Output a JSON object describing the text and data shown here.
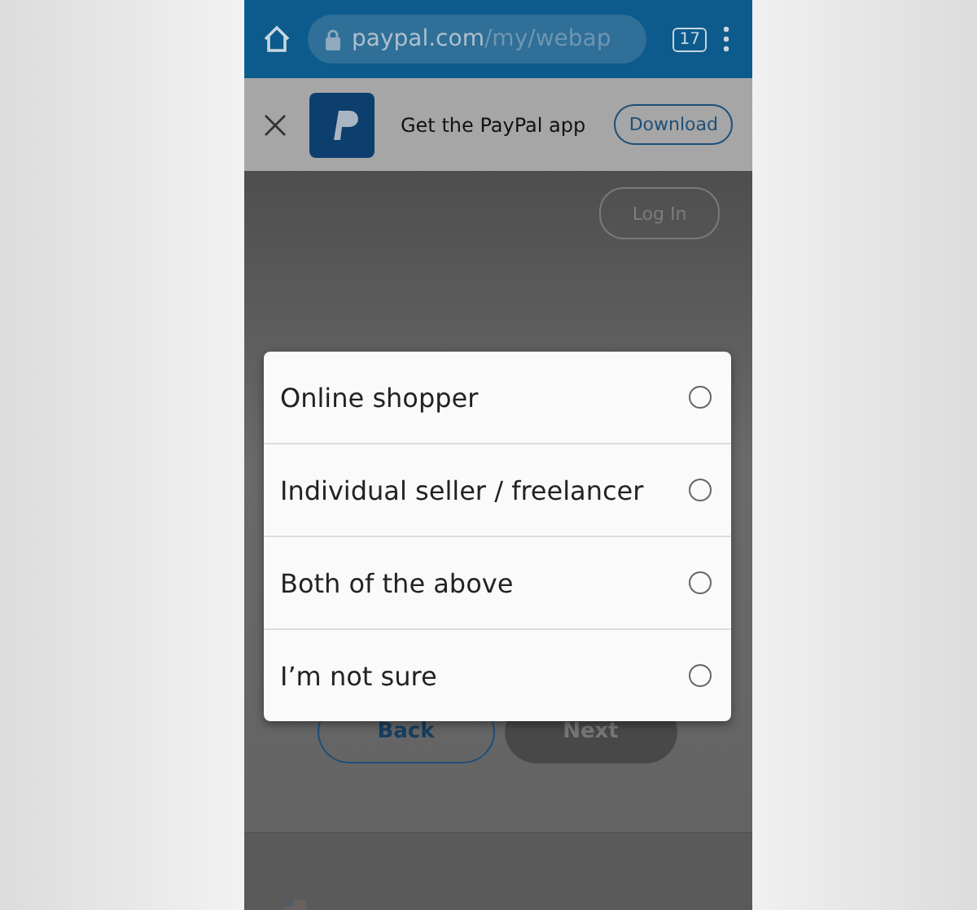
{
  "browser": {
    "url_host": "paypal.com",
    "url_path": "/my/webap",
    "tab_count": "17"
  },
  "app_banner": {
    "text": "Get the PayPal app",
    "button": "Download"
  },
  "header": {
    "login": "Log In"
  },
  "dialog": {
    "options": [
      {
        "label": "Online shopper",
        "selected": false
      },
      {
        "label": "Individual seller / freelancer",
        "selected": false
      },
      {
        "label": "Both of the above",
        "selected": false
      },
      {
        "label": "I’m not sure",
        "selected": false
      }
    ]
  },
  "buttons": {
    "back": "Back",
    "next": "Next",
    "next_disabled": true
  }
}
